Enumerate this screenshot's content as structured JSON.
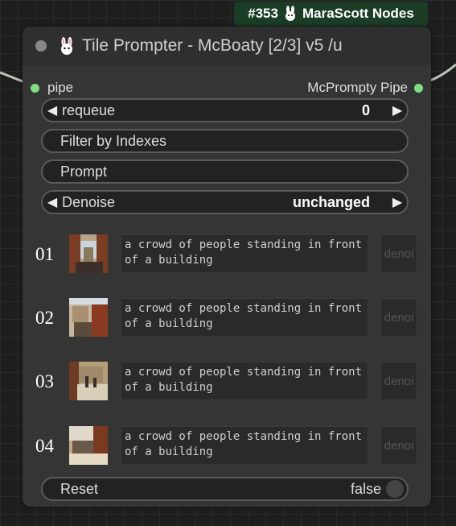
{
  "badge": {
    "id": "#353",
    "label": "MaraScott Nodes"
  },
  "node": {
    "title": "Tile Prompter - McBoaty [2/3] v5 /u",
    "input_label": "pipe",
    "output_label": "McPrompty Pipe",
    "requeue": {
      "label": "requeue",
      "value": "0"
    },
    "filter_label": "Filter by Indexes",
    "prompt_label": "Prompt",
    "denoise": {
      "label": "Denoise",
      "value": "unchanged"
    },
    "tiles": [
      {
        "index": "01",
        "prompt": "a crowd of people standing in front of a building",
        "denoise_placeholder": "denoi"
      },
      {
        "index": "02",
        "prompt": "a crowd of people standing in front of a building",
        "denoise_placeholder": "denoi"
      },
      {
        "index": "03",
        "prompt": "a crowd of people standing in front of a building",
        "denoise_placeholder": "denoi"
      },
      {
        "index": "04",
        "prompt": "a crowd of people standing in front of a building",
        "denoise_placeholder": "denoi"
      }
    ],
    "reset": {
      "label": "Reset",
      "value": "false"
    }
  },
  "colors": {
    "slot": "#7fdf7f",
    "badge_bg": "#1b3d25",
    "node_bg": "#353535"
  }
}
